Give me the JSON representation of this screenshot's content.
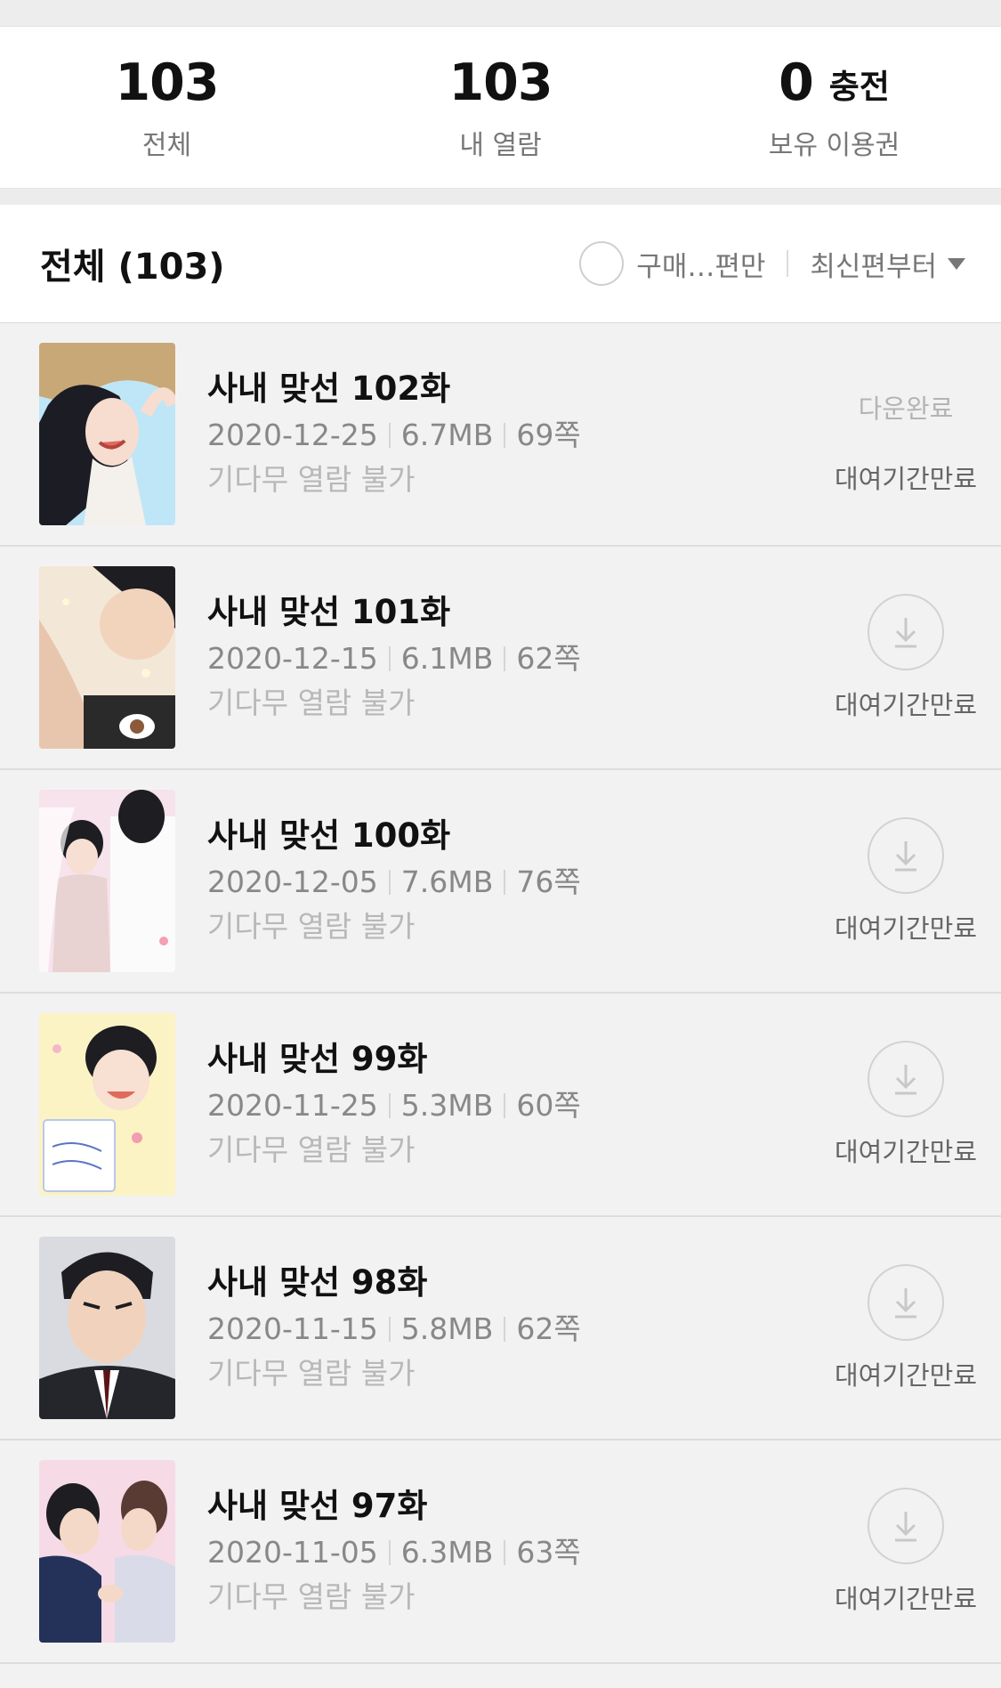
{
  "stats": {
    "total": {
      "value": "103",
      "label": "전체"
    },
    "viewed": {
      "value": "103",
      "label": "내 열람"
    },
    "tickets": {
      "value": "0",
      "charge_label": "충전",
      "label": "보유 이용권"
    }
  },
  "list_header": {
    "title": "전체 (103)",
    "filter_label": "구매…편만",
    "sort_label": "최신편부터"
  },
  "episodes": [
    {
      "title": "사내 맞선 102화",
      "date": "2020-12-25",
      "size": "6.7MB",
      "pages": "69쪽",
      "status": "기다무 열람 불가",
      "download_text": "다운완료",
      "rental": "대여기간만료",
      "downloaded": true
    },
    {
      "title": "사내 맞선 101화",
      "date": "2020-12-15",
      "size": "6.1MB",
      "pages": "62쪽",
      "status": "기다무 열람 불가",
      "rental": "대여기간만료",
      "downloaded": false
    },
    {
      "title": "사내 맞선 100화",
      "date": "2020-12-05",
      "size": "7.6MB",
      "pages": "76쪽",
      "status": "기다무 열람 불가",
      "rental": "대여기간만료",
      "downloaded": false
    },
    {
      "title": "사내 맞선 99화",
      "date": "2020-11-25",
      "size": "5.3MB",
      "pages": "60쪽",
      "status": "기다무 열람 불가",
      "rental": "대여기간만료",
      "downloaded": false
    },
    {
      "title": "사내 맞선 98화",
      "date": "2020-11-15",
      "size": "5.8MB",
      "pages": "62쪽",
      "status": "기다무 열람 불가",
      "rental": "대여기간만료",
      "downloaded": false
    },
    {
      "title": "사내 맞선 97화",
      "date": "2020-11-05",
      "size": "6.3MB",
      "pages": "63쪽",
      "status": "기다무 열람 불가",
      "rental": "대여기간만료",
      "downloaded": false
    }
  ],
  "colors": {
    "charge_underline": "#ffd84d",
    "row_background": "#f2f2f2",
    "muted_text": "#888888"
  }
}
